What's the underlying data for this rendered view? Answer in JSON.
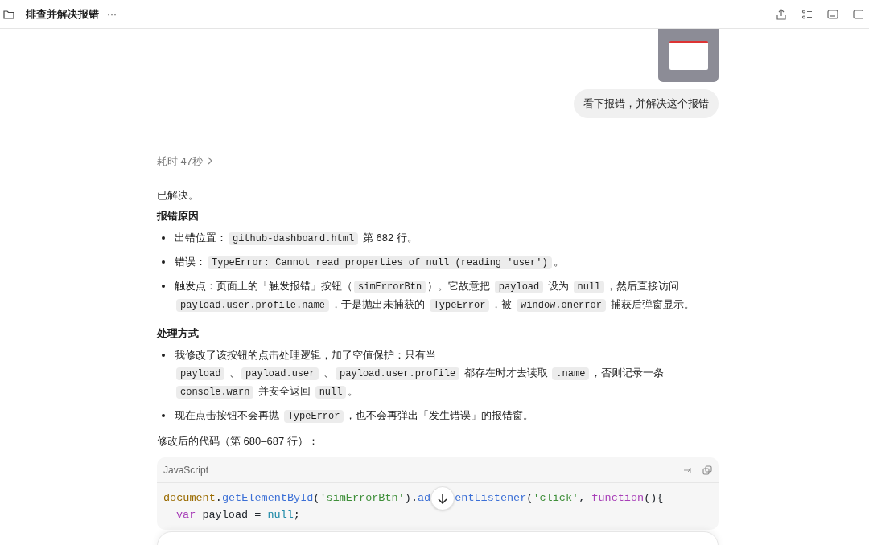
{
  "header": {
    "title": "排查并解决报错",
    "more": "···"
  },
  "user_message": {
    "text": "看下报错，并解决这个报错"
  },
  "reasoning": {
    "label": "耗时 47秒",
    "expanded": false
  },
  "answer": {
    "intro": "已解决。",
    "sections": [
      {
        "heading": "报错原因",
        "bullets": [
          [
            {
              "kind": "text",
              "t": "出错位置："
            },
            {
              "kind": "code",
              "t": "github-dashboard.html"
            },
            {
              "kind": "text",
              "t": " 第 682 行。"
            }
          ],
          [
            {
              "kind": "text",
              "t": "错误："
            },
            {
              "kind": "code",
              "t": "TypeError: Cannot read properties of null (reading 'user')"
            },
            {
              "kind": "text",
              "t": "。"
            }
          ],
          [
            {
              "kind": "text",
              "t": "触发点：页面上的「触发报错」按钮（"
            },
            {
              "kind": "code",
              "t": "simErrorBtn"
            },
            {
              "kind": "text",
              "t": "）。它故意把 "
            },
            {
              "kind": "code",
              "t": "payload"
            },
            {
              "kind": "text",
              "t": " 设为 "
            },
            {
              "kind": "code",
              "t": "null"
            },
            {
              "kind": "text",
              "t": "，然后直接访问 "
            },
            {
              "kind": "code",
              "t": "payload.user.profile.name"
            },
            {
              "kind": "text",
              "t": "，于是抛出未捕获的 "
            },
            {
              "kind": "code",
              "t": "TypeError"
            },
            {
              "kind": "text",
              "t": "，被 "
            },
            {
              "kind": "code",
              "t": "window.onerror"
            },
            {
              "kind": "text",
              "t": " 捕获后弹窗显示。"
            }
          ]
        ]
      },
      {
        "heading": "处理方式",
        "bullets": [
          [
            {
              "kind": "text",
              "t": "我修改了该按钮的点击处理逻辑，加了空值保护：只有当"
            },
            {
              "kind": "break"
            },
            {
              "kind": "code",
              "t": "payload"
            },
            {
              "kind": "text",
              "t": " 、"
            },
            {
              "kind": "code",
              "t": "payload.user"
            },
            {
              "kind": "text",
              "t": " 、"
            },
            {
              "kind": "code",
              "t": "payload.user.profile"
            },
            {
              "kind": "text",
              "t": " 都存在时才去读取 "
            },
            {
              "kind": "code",
              "t": ".name"
            },
            {
              "kind": "text",
              "t": "，否则记录一条 "
            },
            {
              "kind": "code",
              "t": "console.warn"
            },
            {
              "kind": "text",
              "t": " 并安全返回 "
            },
            {
              "kind": "code",
              "t": "null"
            },
            {
              "kind": "text",
              "t": "。"
            }
          ],
          [
            {
              "kind": "text",
              "t": "现在点击按钮不会再抛 "
            },
            {
              "kind": "code",
              "t": "TypeError"
            },
            {
              "kind": "text",
              "t": "，也不会再弹出「发生错误」的报错窗。"
            }
          ]
        ]
      }
    ],
    "code_caption": "修改后的代码（第 680–687 行）：",
    "code_block": {
      "language": "JavaScript",
      "lines": [
        [
          {
            "kind": "object",
            "t": "document"
          },
          {
            "kind": "plain",
            "t": "."
          },
          {
            "kind": "method",
            "t": "getElementById"
          },
          {
            "kind": "plain",
            "t": "("
          },
          {
            "kind": "string",
            "t": "'simErrorBtn'"
          },
          {
            "kind": "plain",
            "t": ")."
          },
          {
            "kind": "method",
            "t": "ad"
          },
          {
            "kind": "gap"
          },
          {
            "kind": "method",
            "t": "entListener"
          },
          {
            "kind": "plain",
            "t": "("
          },
          {
            "kind": "string",
            "t": "'click'"
          },
          {
            "kind": "plain",
            "t": ", "
          },
          {
            "kind": "keyword",
            "t": "function"
          },
          {
            "kind": "plain",
            "t": "(){"
          }
        ],
        [
          {
            "kind": "indent"
          },
          {
            "kind": "keyword",
            "t": "var"
          },
          {
            "kind": "plain",
            "t": " payload = "
          },
          {
            "kind": "literal",
            "t": "null"
          },
          {
            "kind": "plain",
            "t": ";"
          }
        ]
      ]
    }
  }
}
